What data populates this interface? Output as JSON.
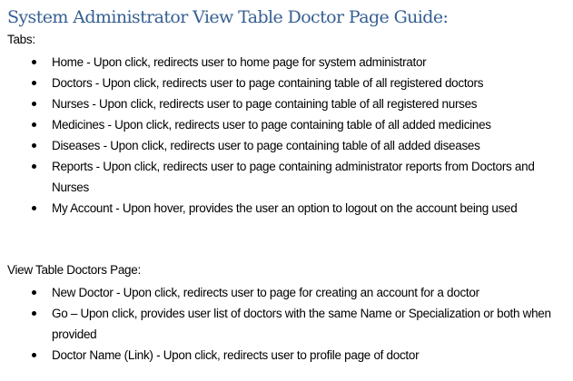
{
  "title": "System Administrator View Table Doctor Page Guide:",
  "tabs_section": {
    "label": "Tabs:",
    "items": [
      "Home - Upon click, redirects user to home page for system administrator",
      "Doctors - Upon click, redirects user to page containing table of all registered doctors",
      "Nurses - Upon click, redirects user to page containing table of all registered nurses",
      "Medicines - Upon click, redirects user to page containing table of all added medicines",
      "Diseases - Upon click, redirects user to page containing table of all added diseases",
      "Reports - Upon click, redirects user to page containing administrator reports from Doctors and Nurses",
      "My Account - Upon hover, provides the user an option to logout on the account being used"
    ]
  },
  "page_section": {
    "label": "View Table Doctors Page:",
    "items": [
      "New Doctor - Upon click, redirects user to page for creating an account for a doctor",
      "Go – Upon click, provides user list of doctors with the same Name or Specialization or both when provided",
      "Doctor Name (Link)  - Upon click, redirects user to profile page of doctor"
    ]
  }
}
